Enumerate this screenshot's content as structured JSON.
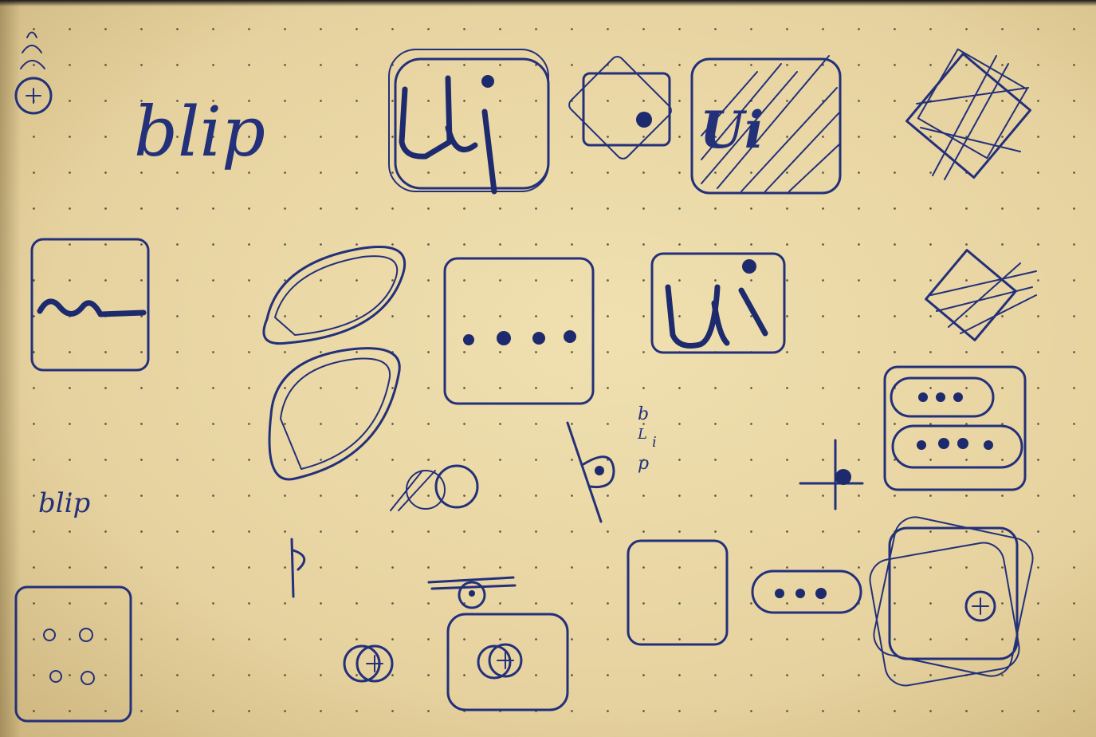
{
  "handwriting": {
    "blip_word": "blip",
    "blip_word_small": "blip",
    "blip_vertical": [
      "b",
      "L",
      "i",
      "p"
    ],
    "ui_letters": "Ui"
  },
  "colors": {
    "paper": "#e9d8a8",
    "ink": "#23307a",
    "dots": "#2c2a24"
  }
}
